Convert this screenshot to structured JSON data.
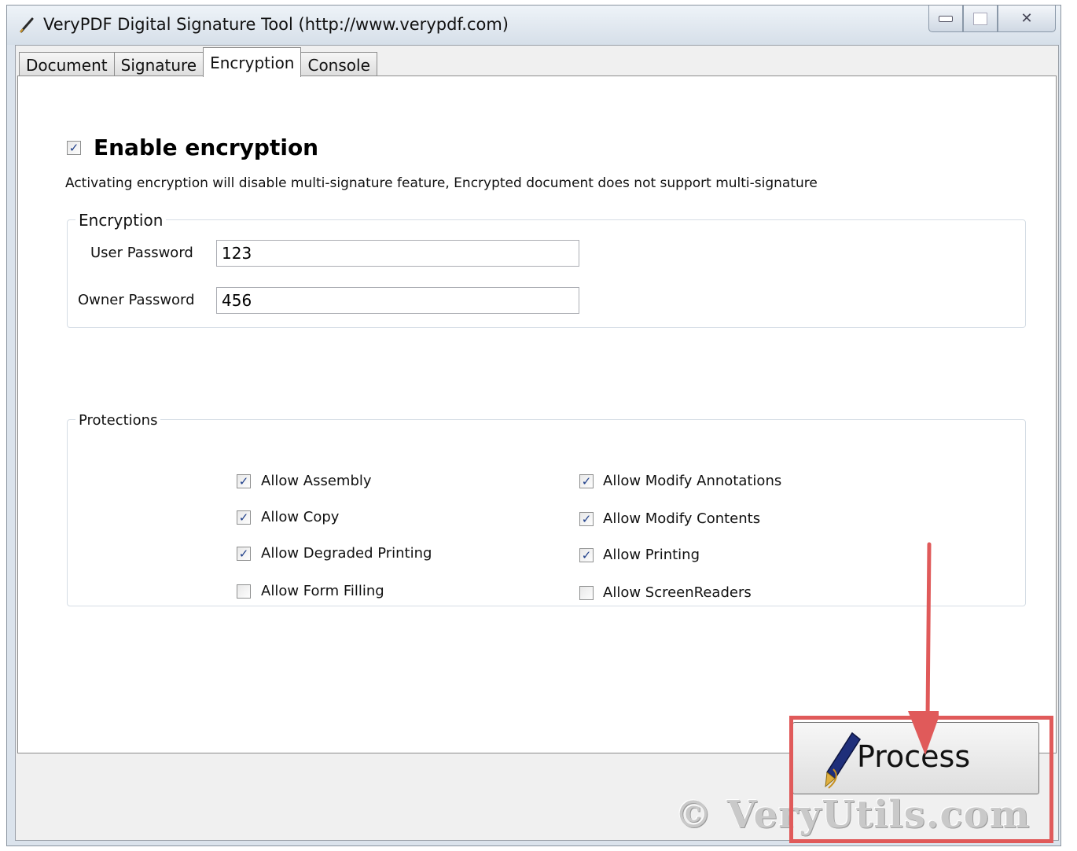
{
  "window": {
    "title": "VeryPDF Digital Signature Tool (http://www.verypdf.com)",
    "icon": "pen-icon"
  },
  "tabs": [
    {
      "label": "Document",
      "active": false
    },
    {
      "label": "Signature",
      "active": false
    },
    {
      "label": "Encryption",
      "active": true
    },
    {
      "label": "Console",
      "active": false
    }
  ],
  "encryption_tab": {
    "enable_label": "Enable encryption",
    "enable_checked": true,
    "notice": "Activating encryption will disable multi-signature feature, Encrypted document does not support multi-signature",
    "encryption_group": {
      "legend": "Encryption",
      "user_password_label": "User Password",
      "user_password_value": "123",
      "owner_password_label": "Owner Password",
      "owner_password_value": "456"
    },
    "protections_group": {
      "legend": "Protections",
      "options": [
        {
          "label": "Allow Assembly",
          "checked": true
        },
        {
          "label": "Allow Copy",
          "checked": true
        },
        {
          "label": "Allow Degraded Printing",
          "checked": true
        },
        {
          "label": "Allow Form Filling",
          "checked": false
        },
        {
          "label": "Allow Modify Annotations",
          "checked": true
        },
        {
          "label": "Allow Modify Contents",
          "checked": true
        },
        {
          "label": "Allow Printing",
          "checked": true
        },
        {
          "label": "Allow ScreenReaders",
          "checked": false
        }
      ]
    }
  },
  "footer": {
    "process_label": "Process"
  },
  "overlay": {
    "watermark": "© VeryUtils.com",
    "highlight_color": "#e05a5a"
  }
}
